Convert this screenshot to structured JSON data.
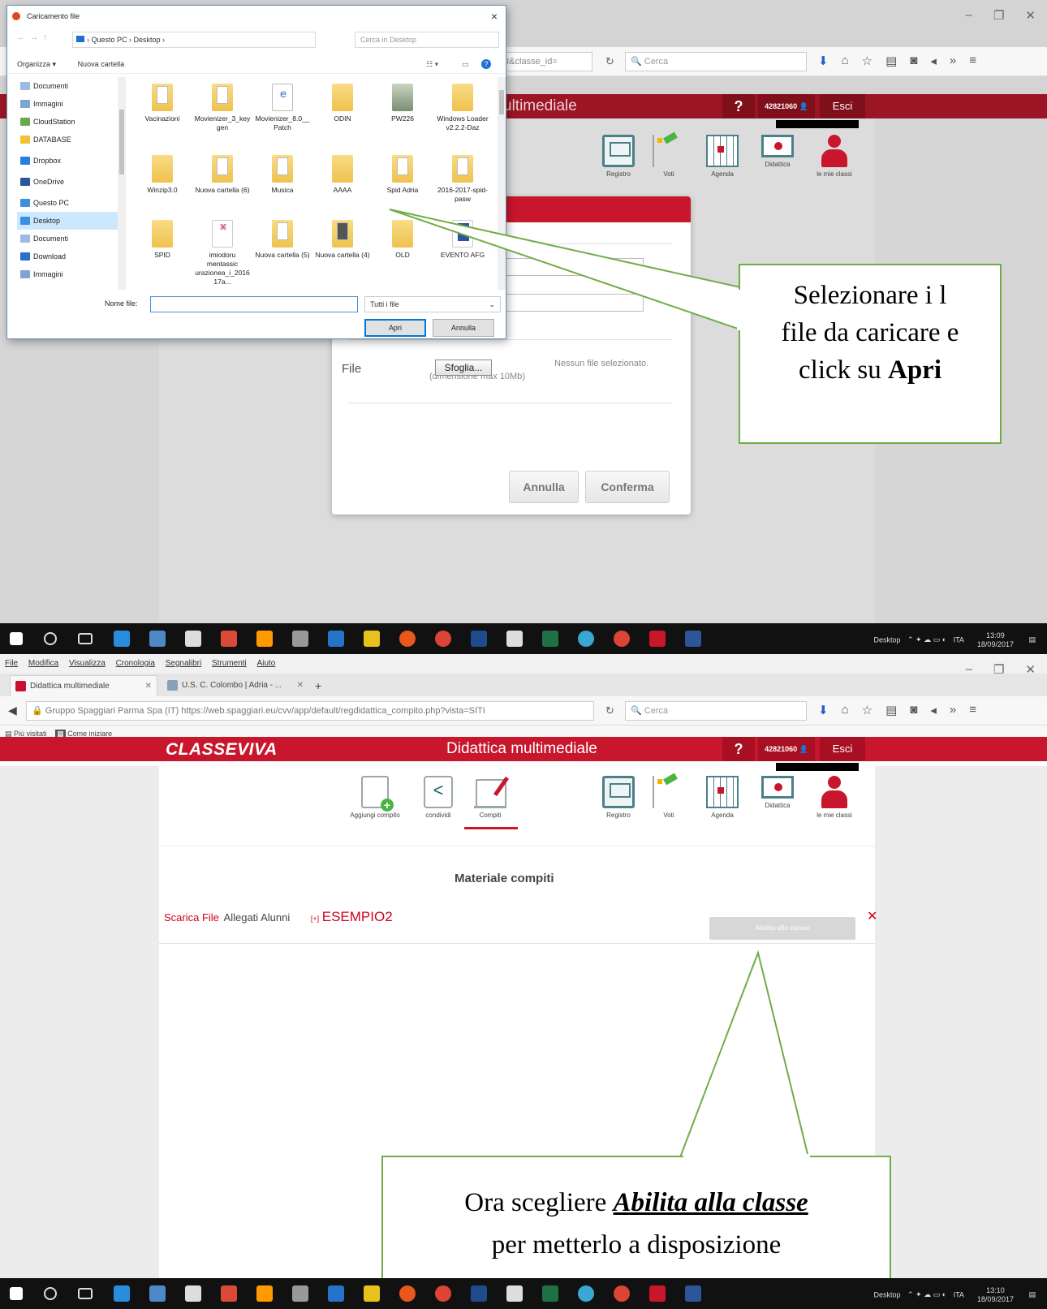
{
  "shot1": {
    "dialog": {
      "title": "Caricamento file",
      "close": "×",
      "address": "› Questo PC › Desktop ›",
      "search_placeholder": "Cerca in Desktop",
      "organize": "Organizza ▾",
      "new_folder": "Nuova cartella",
      "tree": [
        {
          "label": "Documenti"
        },
        {
          "label": "Immagini"
        },
        {
          "label": "CloudStation"
        },
        {
          "label": "DATABASE"
        },
        {
          "label": "Dropbox"
        },
        {
          "label": "OneDrive"
        },
        {
          "label": "Questo PC"
        },
        {
          "label": "Desktop"
        },
        {
          "label": "Documenti"
        },
        {
          "label": "Download"
        },
        {
          "label": "Immagini"
        }
      ],
      "files": [
        {
          "label": "Vacinazioni"
        },
        {
          "label": "Movienizer_3_keygen"
        },
        {
          "label": "Movienizer_8.0__Patch"
        },
        {
          "label": "ODIN"
        },
        {
          "label": "PW226"
        },
        {
          "label": "Windows Loader v2.2.2-Daz"
        },
        {
          "label": "Winzip3.0"
        },
        {
          "label": "Nuova cartella (6)"
        },
        {
          "label": "Musica"
        },
        {
          "label": "AAAA"
        },
        {
          "label": "Spid Adria"
        },
        {
          "label": "2016-2017-spid-pasw"
        },
        {
          "label": "SPID"
        },
        {
          "label": "imiodoru mentassic urazionea_i_201617a..."
        },
        {
          "label": "Nuova cartella (5)"
        },
        {
          "label": "Nuova cartella (4)"
        },
        {
          "label": "OLD"
        },
        {
          "label": "EVENTO AFG"
        }
      ],
      "filename_label": "Nome file:",
      "filter": "Tutti i file",
      "open_button": "Apri",
      "cancel_button": "Annulla"
    },
    "browser": {
      "url_fragment": "SITI&classe_id=",
      "search": "Cerca"
    },
    "site": {
      "page_title": "ultimediale",
      "qmark": "?",
      "user_code": "42821060",
      "logout": "Esci",
      "nav": [
        "Registro",
        "Voti",
        "Agenda",
        "Didattica",
        "le mie classi"
      ]
    },
    "modal": {
      "file_label": "File",
      "browse_button": "Sfoglia...",
      "no_file": "Nessun file selezionato.",
      "max_size": "(dimensione max 10Mb)",
      "cancel": "Annulla",
      "confirm": "Conferma"
    },
    "callout": {
      "line1": "Selezionare i l",
      "line2": "file da caricare e",
      "line3_prefix": "click su ",
      "line3_bold": "Apri"
    },
    "taskbar": {
      "desktop": "Desktop",
      "lang": "ITA",
      "time": "13:09",
      "date": "18/09/2017"
    }
  },
  "shot2": {
    "menu": [
      "File",
      "Modifica",
      "Visualizza",
      "Cronologia",
      "Segnalibri",
      "Strumenti",
      "Aiuto"
    ],
    "tabs": [
      {
        "label": "Didattica multimediale"
      },
      {
        "label": "U.S. C. Colombo | Adria - ..."
      }
    ],
    "new_tab": "+",
    "url": "Gruppo Spaggiari Parma Spa (IT)  https://web.spaggiari.eu/cvv/app/default/regdidattica_compito.php?vista=SITI",
    "search": "Cerca",
    "bookmarks": [
      "Più visitati",
      "Come iniziare"
    ],
    "site": {
      "logo": "CLASSEVIVA",
      "page_title": "Didattica multimediale",
      "qmark": "?",
      "user_code": "42821060",
      "logout": "Esci",
      "nav_left": [
        "Aggiungi compito",
        "condividi",
        "Compiti"
      ],
      "nav_right": [
        "Registro",
        "Voti",
        "Agenda",
        "Didattica",
        "le mie classi"
      ]
    },
    "section_title": "Materiale compiti",
    "row": {
      "download": "Scarica File",
      "attachments": "Allegati Alunni",
      "expand": "[+]",
      "filename": "ESEMPIO2",
      "enable_button": "Abilita alla classe",
      "delete": "✕"
    },
    "callout": {
      "line1_prefix": "Ora scegliere ",
      "line1_em": "Abilita alla classe",
      "line2": "per metterlo a disposizione"
    },
    "taskbar": {
      "desktop": "Desktop",
      "lang": "ITA",
      "time": "13:10",
      "date": "18/09/2017"
    }
  },
  "colors": {
    "brand_red": "#c8172c",
    "callout_border": "#70ad47",
    "taskbar": "#111111"
  }
}
